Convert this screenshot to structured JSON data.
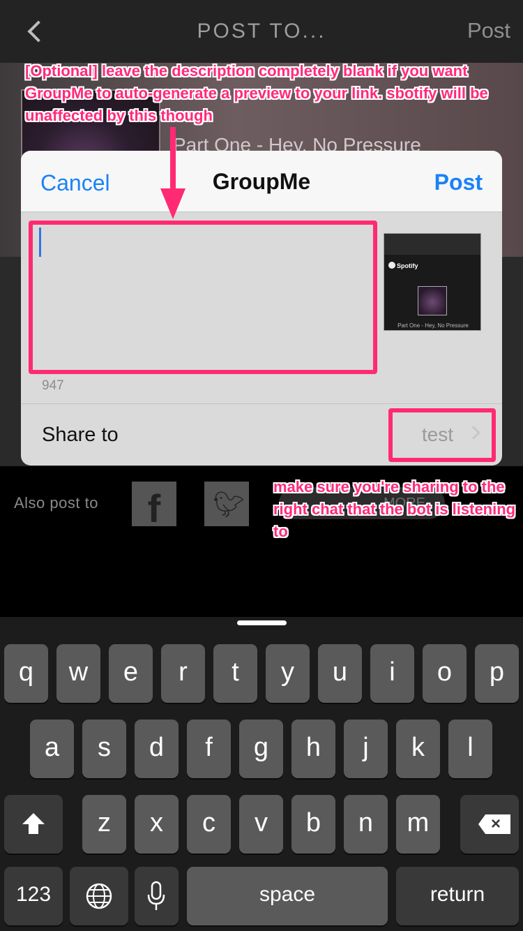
{
  "nav": {
    "title": "POST TO...",
    "post_label": "Post"
  },
  "background": {
    "track_title": "Part One - Hey, No Pressure",
    "also_post_label": "Also post to",
    "more_label": "MORE"
  },
  "sheet": {
    "cancel_label": "Cancel",
    "title": "GroupMe",
    "post_label": "Post",
    "description_value": "",
    "char_count": "947",
    "preview": {
      "brand": "Spotify",
      "caption": "Part One - Hey, No Pressure"
    },
    "share_to_label": "Share to",
    "share_to_value": "test"
  },
  "annotations": {
    "top_note": "[Optional] leave the description completely blank if you want GroupMe to auto-generate a preview to your link. sbotify will be unaffected by this though",
    "bottom_note": "make sure you're sharing to the right chat that the bot is listening to"
  },
  "keyboard": {
    "row1": [
      "q",
      "w",
      "e",
      "r",
      "t",
      "y",
      "u",
      "i",
      "o",
      "p"
    ],
    "row2": [
      "a",
      "s",
      "d",
      "f",
      "g",
      "h",
      "j",
      "k",
      "l"
    ],
    "row3": [
      "z",
      "x",
      "c",
      "v",
      "b",
      "n",
      "m"
    ],
    "numbers_label": "123",
    "space_label": "space",
    "return_label": "return"
  },
  "colors": {
    "annotation": "#ff2a73",
    "link_blue": "#1a82f7",
    "key": "#5a5a5a",
    "key_dark": "#393939"
  },
  "icons": [
    "back-chevron-icon",
    "facebook-icon",
    "twitter-icon",
    "chevron-right-icon",
    "shift-icon",
    "delete-icon",
    "globe-icon",
    "microphone-icon",
    "spotify-icon"
  ]
}
